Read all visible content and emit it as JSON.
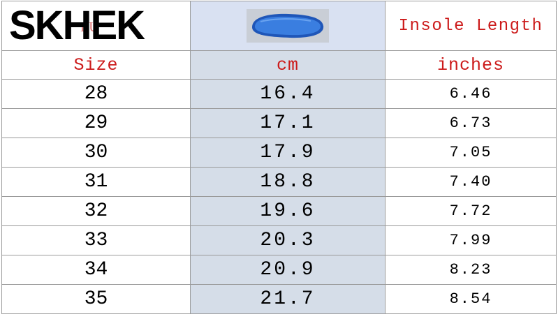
{
  "brand": "SKHEK",
  "banner": {
    "eu_label": "EU",
    "image_icon": "insole-image",
    "title": "Insole Length"
  },
  "headers": {
    "size": "Size",
    "cm": "cm",
    "inches": "inches"
  },
  "rows": [
    {
      "size": "28",
      "cm": "16.4",
      "inches": "6.46"
    },
    {
      "size": "29",
      "cm": "17.1",
      "inches": "6.73"
    },
    {
      "size": "30",
      "cm": "17.9",
      "inches": "7.05"
    },
    {
      "size": "31",
      "cm": "18.8",
      "inches": "7.40"
    },
    {
      "size": "32",
      "cm": "19.6",
      "inches": "7.72"
    },
    {
      "size": "33",
      "cm": "20.3",
      "inches": "7.99"
    },
    {
      "size": "34",
      "cm": "20.9",
      "inches": "8.23"
    },
    {
      "size": "35",
      "cm": "21.7",
      "inches": "8.54"
    }
  ],
  "colors": {
    "header_text": "#cc1a1a",
    "middle_column_bg": "#d5dde8",
    "insole_blue": "#2f6fd0",
    "grid_border": "#9a9a9a"
  }
}
